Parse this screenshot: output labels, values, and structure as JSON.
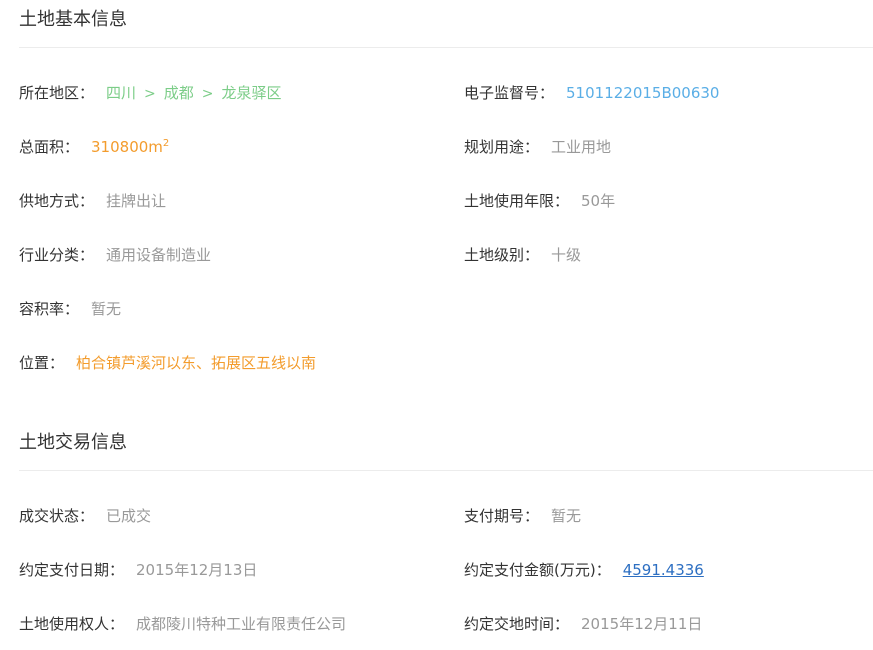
{
  "basic": {
    "title": "土地基本信息",
    "region": {
      "label": "所在地区：",
      "path": [
        "四川",
        "成都",
        "龙泉驿区"
      ],
      "separator": ">"
    },
    "supervision_no": {
      "label": "电子监督号：",
      "value": "5101122015B00630"
    },
    "area": {
      "label": "总面积：",
      "value": "310800m",
      "unit_sup": "2"
    },
    "planned_use": {
      "label": "规划用途：",
      "value": "工业用地"
    },
    "supply_method": {
      "label": "供地方式：",
      "value": "挂牌出让"
    },
    "use_years": {
      "label": "土地使用年限：",
      "value": "50年"
    },
    "industry": {
      "label": "行业分类：",
      "value": "通用设备制造业"
    },
    "land_grade": {
      "label": "土地级别：",
      "value": "十级"
    },
    "plot_ratio": {
      "label": "容积率：",
      "value": "暂无"
    },
    "location": {
      "label": "位置：",
      "value": "柏合镇芦溪河以东、拓展区五线以南"
    }
  },
  "trade": {
    "title": "土地交易信息",
    "status": {
      "label": "成交状态：",
      "value": "已成交"
    },
    "payment_period": {
      "label": "支付期号：",
      "value": "暂无"
    },
    "payment_date": {
      "label": "约定支付日期：",
      "value": "2015年12月13日"
    },
    "payment_amount": {
      "label": "约定支付金额(万元)：",
      "value": "4591.4336"
    },
    "land_user": {
      "label": "土地使用权人：",
      "value": "成都陵川特种工业有限责任公司"
    },
    "delivery_time": {
      "label": "约定交地时间：",
      "value": "2015年12月11日"
    }
  },
  "colors": {
    "label": "#333333",
    "value_grey": "#999999",
    "value_green": "#7ccd88",
    "value_blue": "#5aaee6",
    "value_orange": "#f39c2d",
    "link": "#2d6fc2",
    "divider": "#ececec"
  }
}
